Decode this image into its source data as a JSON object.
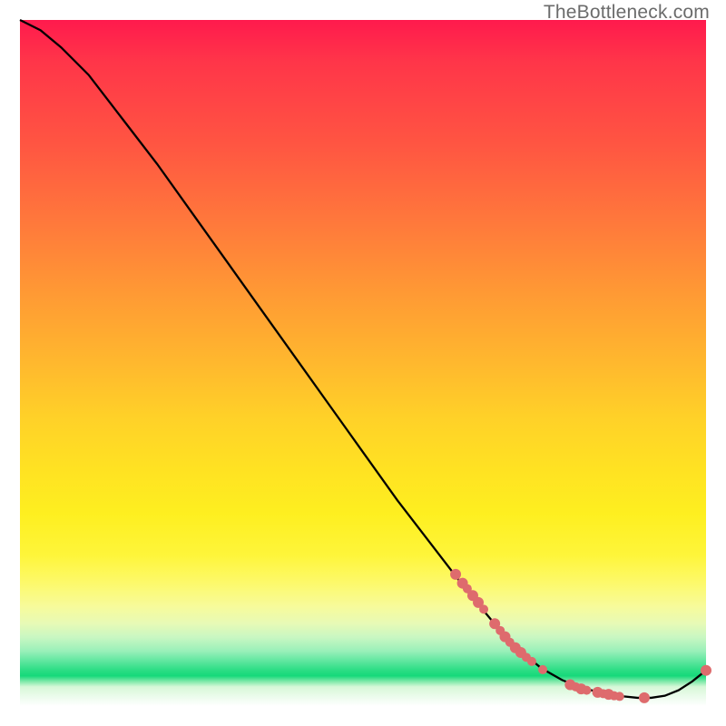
{
  "watermark_text": "TheBottleneck.com",
  "chart_data": {
    "type": "line",
    "title": "",
    "xlabel": "",
    "ylabel": "",
    "xlim": [
      0,
      100
    ],
    "ylim": [
      0,
      100
    ],
    "grid": false,
    "gradient_description": "Vertical red-to-green heat gradient indicating bottleneck severity (red = high, green = low)",
    "series": [
      {
        "name": "bottleneck-curve",
        "color": "#000000",
        "x": [
          0,
          3,
          6,
          10,
          15,
          20,
          25,
          30,
          35,
          40,
          45,
          50,
          55,
          60,
          65,
          70,
          73,
          76,
          79,
          82,
          85,
          88,
          90,
          92,
          94,
          96,
          98,
          100
        ],
        "y": [
          100,
          98.5,
          96,
          92,
          85.5,
          79,
          72,
          65,
          58,
          51,
          44,
          37,
          30,
          23.5,
          17,
          11,
          8,
          5.5,
          3.8,
          2.6,
          1.9,
          1.4,
          1.2,
          1.2,
          1.5,
          2.3,
          3.6,
          5.2
        ]
      }
    ],
    "markers": [
      {
        "series": "bottleneck-curve",
        "color": "#de6b6d",
        "points": [
          {
            "x": 63.5,
            "y": 19.2,
            "r": 6
          },
          {
            "x": 64.5,
            "y": 17.9,
            "r": 6
          },
          {
            "x": 65.2,
            "y": 17.1,
            "r": 5
          },
          {
            "x": 66.0,
            "y": 16.1,
            "r": 6
          },
          {
            "x": 66.8,
            "y": 15.1,
            "r": 6
          },
          {
            "x": 67.6,
            "y": 14.1,
            "r": 5
          },
          {
            "x": 69.2,
            "y": 12.0,
            "r": 6
          },
          {
            "x": 70.0,
            "y": 11.0,
            "r": 5
          },
          {
            "x": 70.7,
            "y": 10.1,
            "r": 6
          },
          {
            "x": 71.4,
            "y": 9.3,
            "r": 5
          },
          {
            "x": 72.2,
            "y": 8.5,
            "r": 6
          },
          {
            "x": 73.0,
            "y": 7.8,
            "r": 6
          },
          {
            "x": 73.8,
            "y": 7.1,
            "r": 5
          },
          {
            "x": 74.6,
            "y": 6.5,
            "r": 5
          },
          {
            "x": 76.2,
            "y": 5.3,
            "r": 5
          },
          {
            "x": 80.2,
            "y": 3.1,
            "r": 6
          },
          {
            "x": 81.0,
            "y": 2.8,
            "r": 5
          },
          {
            "x": 81.8,
            "y": 2.5,
            "r": 6
          },
          {
            "x": 82.6,
            "y": 2.3,
            "r": 5
          },
          {
            "x": 84.2,
            "y": 2.0,
            "r": 6
          },
          {
            "x": 85.0,
            "y": 1.8,
            "r": 5
          },
          {
            "x": 85.8,
            "y": 1.7,
            "r": 6
          },
          {
            "x": 86.6,
            "y": 1.5,
            "r": 5
          },
          {
            "x": 87.4,
            "y": 1.4,
            "r": 5
          },
          {
            "x": 91.0,
            "y": 1.2,
            "r": 6
          },
          {
            "x": 100.0,
            "y": 5.2,
            "r": 6
          }
        ]
      }
    ]
  }
}
